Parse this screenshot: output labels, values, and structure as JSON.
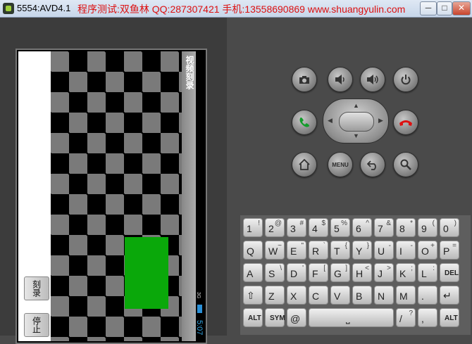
{
  "window": {
    "title": "5554:AVD4.1",
    "subtitle": "程序测试:双鱼林 QQ:287307421 手机:13558690869 www.shuangyulin.com",
    "minimize": "─",
    "maximize": "□",
    "close": "✕"
  },
  "app": {
    "title": "视频刻录",
    "buttons": {
      "record": "刻录",
      "stop": "停止"
    },
    "status": {
      "signal": "3G",
      "time": "5:07"
    }
  },
  "device_buttons": {
    "camera": "camera-icon",
    "volume_down": "volume-down-icon",
    "volume_up": "volume-up-icon",
    "power": "power-icon",
    "call": "call-icon",
    "end_call": "end-call-icon",
    "home": "home-icon",
    "menu": "MENU",
    "back": "back-icon",
    "search": "search-icon"
  },
  "keyboard": {
    "rows": [
      [
        [
          "1",
          "!"
        ],
        [
          "2",
          "@"
        ],
        [
          "3",
          "#"
        ],
        [
          "4",
          "$"
        ],
        [
          "5",
          "%"
        ],
        [
          "6",
          "^"
        ],
        [
          "7",
          "&"
        ],
        [
          "8",
          "*"
        ],
        [
          "9",
          "("
        ],
        [
          "0",
          ")"
        ]
      ],
      [
        [
          "Q",
          ""
        ],
        [
          "W",
          "~"
        ],
        [
          "E",
          "\""
        ],
        [
          "R",
          "`"
        ],
        [
          "T",
          "{"
        ],
        [
          "Y",
          "}"
        ],
        [
          "U",
          "-"
        ],
        [
          "I",
          "-"
        ],
        [
          "O",
          "+"
        ],
        [
          "P",
          "="
        ]
      ],
      [
        [
          "A",
          ""
        ],
        [
          "S",
          "\\"
        ],
        [
          "D",
          "'"
        ],
        [
          "F",
          "["
        ],
        [
          "G",
          "]"
        ],
        [
          "H",
          "<"
        ],
        [
          "J",
          ">"
        ],
        [
          "K",
          ";"
        ],
        [
          "L",
          ":"
        ],
        [
          "DEL",
          ""
        ]
      ],
      [
        [
          "⇧",
          ""
        ],
        [
          "Z",
          ""
        ],
        [
          "X",
          ""
        ],
        [
          "C",
          ""
        ],
        [
          "V",
          ""
        ],
        [
          "B",
          ""
        ],
        [
          "N",
          ""
        ],
        [
          "M",
          ""
        ],
        [
          ".",
          ""
        ],
        [
          "↵",
          ""
        ]
      ],
      [
        [
          "ALT",
          ""
        ],
        [
          "SYM",
          ""
        ],
        [
          "@",
          ""
        ],
        [
          "⎵",
          ""
        ],
        [
          "/",
          "?"
        ],
        [
          ",",
          ""
        ],
        [
          "ALT",
          ""
        ]
      ]
    ]
  },
  "colors": {
    "accent": "#0aa80a",
    "clock": "#33a9e8",
    "title_red": "#d11111"
  }
}
